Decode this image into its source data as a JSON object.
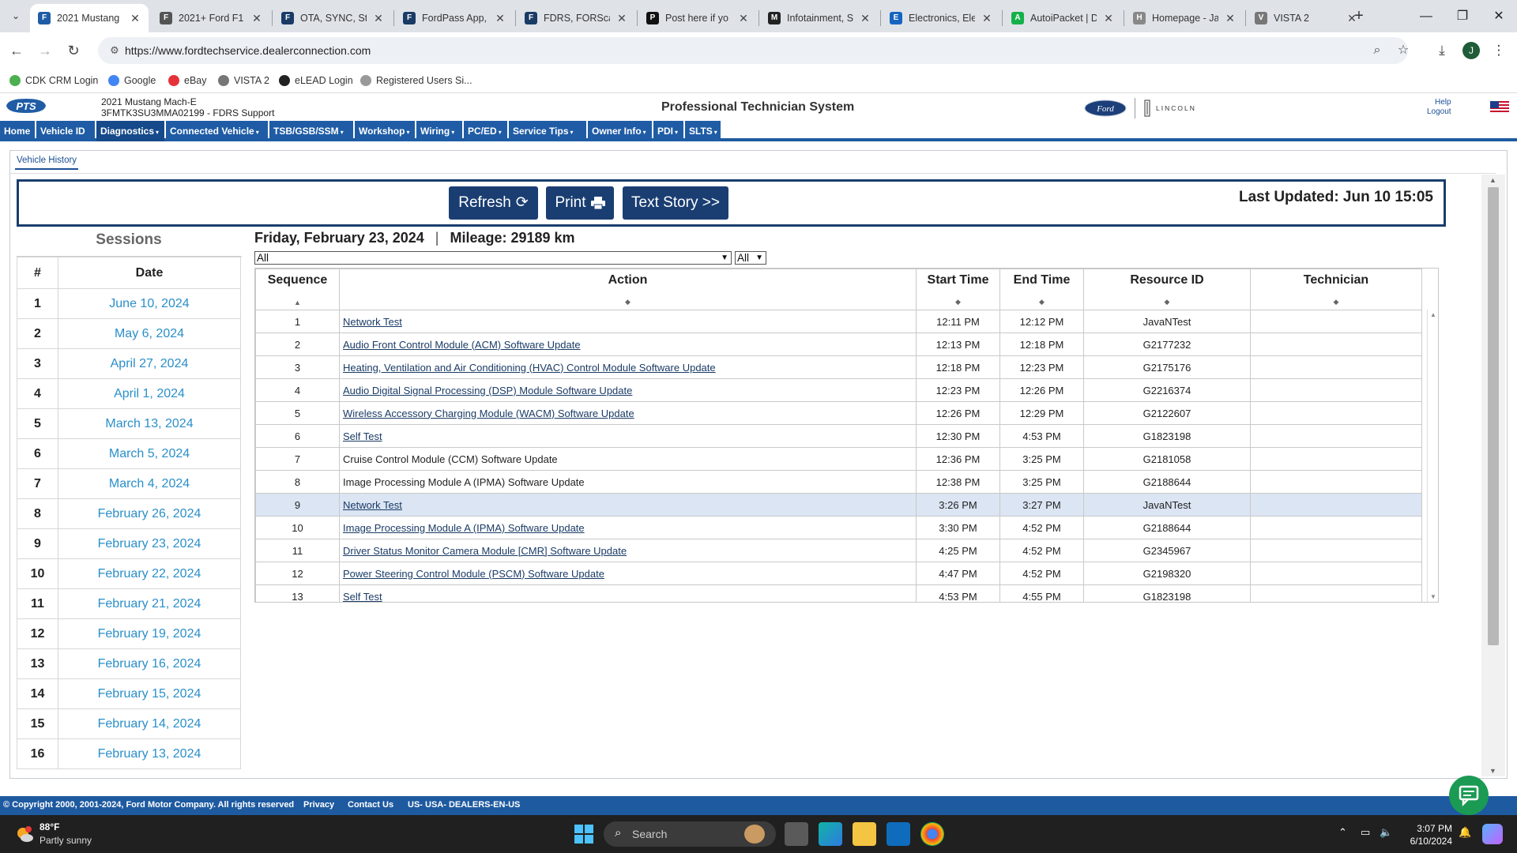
{
  "browser": {
    "tabs": [
      {
        "title": "2021 Mustang",
        "active": true,
        "fav_color": "#1f5ca5",
        "fav": "F"
      },
      {
        "title": "2021+ Ford F1",
        "fav_color": "#555555",
        "fav": "F"
      },
      {
        "title": "OTA, SYNC, Ste",
        "fav_color": "#1a3b66",
        "fav": "F"
      },
      {
        "title": "FordPass App,",
        "fav_color": "#1a3b66",
        "fav": "F"
      },
      {
        "title": "FDRS, FORScan",
        "fav_color": "#1a3b66",
        "fav": "F"
      },
      {
        "title": "Post here if yo",
        "fav_color": "#111111",
        "fav": "P"
      },
      {
        "title": "Infotainment, S",
        "fav_color": "#222222",
        "fav": "M"
      },
      {
        "title": "Electronics, Ele",
        "fav_color": "#1565c0",
        "fav": "E"
      },
      {
        "title": "AutoiPacket | D",
        "fav_color": "#16b04a",
        "fav": "A"
      },
      {
        "title": "Homepage - Ja",
        "fav_color": "#888888",
        "fav": "H"
      },
      {
        "title": "VISTA 2",
        "fav_color": "#777777",
        "fav": "V"
      }
    ],
    "url": "https://www.fordtechservice.dealerconnection.com",
    "bookmarks": [
      {
        "label": "CDK CRM Login",
        "color": "#4caf50"
      },
      {
        "label": "Google",
        "color": "#4285f4"
      },
      {
        "label": "eBay",
        "color": "#e53238"
      },
      {
        "label": "VISTA 2",
        "color": "#777777"
      },
      {
        "label": "eLEAD Login",
        "color": "#222222"
      },
      {
        "label": "Registered Users Si...",
        "color": "#999999"
      }
    ],
    "profile_initial": "J"
  },
  "header": {
    "vehicle_line1": "2021 Mustang Mach-E",
    "vehicle_line2": "3FMTK3SU3MMA02199 - FDRS Support",
    "app_title": "Professional Technician System",
    "lincoln": "LINCOLN",
    "ford_logo_text": "Ford",
    "pts_logo_text": "PTS",
    "help": "Help",
    "logout": "Logout"
  },
  "nav": [
    {
      "label": "Home"
    },
    {
      "label": "Vehicle ID"
    },
    {
      "label": "Diagnostics",
      "selected": true
    },
    {
      "label": "Connected Vehicle"
    },
    {
      "label": "TSB/GSB/SSM"
    },
    {
      "label": "Workshop"
    },
    {
      "label": "Wiring"
    },
    {
      "label": "PC/ED"
    },
    {
      "label": "Service Tips"
    },
    {
      "label": "Owner Info"
    },
    {
      "label": "PDI"
    },
    {
      "label": "SLTS"
    }
  ],
  "subtab": "Vehicle History",
  "toolbar": {
    "refresh": "Refresh",
    "print": "Print",
    "text_story": "Text Story >>",
    "last_updated": "Last Updated: Jun 10 15:05"
  },
  "sessions": {
    "title": "Sessions",
    "col_num": "#",
    "col_date": "Date",
    "rows": [
      {
        "num": "1",
        "date": "June 10, 2024"
      },
      {
        "num": "2",
        "date": "May 6, 2024"
      },
      {
        "num": "3",
        "date": "April 27, 2024"
      },
      {
        "num": "4",
        "date": "April 1, 2024"
      },
      {
        "num": "5",
        "date": "March 13, 2024"
      },
      {
        "num": "6",
        "date": "March 5, 2024"
      },
      {
        "num": "7",
        "date": "March 4, 2024"
      },
      {
        "num": "8",
        "date": "February 26, 2024"
      },
      {
        "num": "9",
        "date": "February 23, 2024"
      },
      {
        "num": "10",
        "date": "February 22, 2024"
      },
      {
        "num": "11",
        "date": "February 21, 2024"
      },
      {
        "num": "12",
        "date": "February 19, 2024"
      },
      {
        "num": "13",
        "date": "February 16, 2024"
      },
      {
        "num": "14",
        "date": "February 15, 2024"
      },
      {
        "num": "15",
        "date": "February 14, 2024"
      },
      {
        "num": "16",
        "date": "February 13, 2024"
      }
    ]
  },
  "detail": {
    "date": "Friday, February 23, 2024",
    "separator": "|",
    "mileage": "Mileage: 29189 km",
    "filter1": "All",
    "filter2": "All",
    "columns": {
      "sequence": "Sequence",
      "action": "Action",
      "start": "Start Time",
      "end": "End Time",
      "resource": "Resource ID",
      "technician": "Technician"
    },
    "rows": [
      {
        "seq": "1",
        "action": "Network Test",
        "link": true,
        "start": "12:11 PM",
        "end": "12:12 PM",
        "res": "JavaNTest",
        "tech": ""
      },
      {
        "seq": "2",
        "action": "Audio Front Control Module (ACM) Software Update",
        "link": true,
        "start": "12:13 PM",
        "end": "12:18 PM",
        "res": "G2177232",
        "tech": ""
      },
      {
        "seq": "3",
        "action": "Heating, Ventilation and Air Conditioning (HVAC) Control Module Software Update",
        "link": true,
        "start": "12:18 PM",
        "end": "12:23 PM",
        "res": "G2175176",
        "tech": ""
      },
      {
        "seq": "4",
        "action": "Audio Digital Signal Processing (DSP) Module Software Update",
        "link": true,
        "start": "12:23 PM",
        "end": "12:26 PM",
        "res": "G2216374",
        "tech": ""
      },
      {
        "seq": "5",
        "action": "Wireless Accessory Charging Module (WACM) Software Update",
        "link": true,
        "start": "12:26 PM",
        "end": "12:29 PM",
        "res": "G2122607",
        "tech": ""
      },
      {
        "seq": "6",
        "action": "Self Test",
        "link": true,
        "start": "12:30 PM",
        "end": "4:53 PM",
        "res": "G1823198",
        "tech": ""
      },
      {
        "seq": "7",
        "action": "Cruise Control Module (CCM) Software Update",
        "link": false,
        "start": "12:36 PM",
        "end": "3:25 PM",
        "res": "G2181058",
        "tech": ""
      },
      {
        "seq": "8",
        "action": "Image Processing Module A (IPMA) Software Update",
        "link": false,
        "start": "12:38 PM",
        "end": "3:25 PM",
        "res": "G2188644",
        "tech": ""
      },
      {
        "seq": "9",
        "action": "Network Test",
        "link": true,
        "start": "3:26 PM",
        "end": "3:27 PM",
        "res": "JavaNTest",
        "tech": "",
        "highlight": true
      },
      {
        "seq": "10",
        "action": "Image Processing Module A (IPMA) Software Update",
        "link": true,
        "start": "3:30 PM",
        "end": "4:52 PM",
        "res": "G2188644",
        "tech": ""
      },
      {
        "seq": "11",
        "action": "Driver Status Monitor Camera Module [CMR] Software Update",
        "link": true,
        "start": "4:25 PM",
        "end": "4:52 PM",
        "res": "G2345967",
        "tech": ""
      },
      {
        "seq": "12",
        "action": "Power Steering Control Module (PSCM) Software Update",
        "link": true,
        "start": "4:47 PM",
        "end": "4:52 PM",
        "res": "G2198320",
        "tech": ""
      },
      {
        "seq": "13",
        "action": "Self Test",
        "link": true,
        "start": "4:53 PM",
        "end": "4:55 PM",
        "res": "G1823198",
        "tech": ""
      }
    ]
  },
  "footer": {
    "copyright": "© Copyright 2000, 2001-2024, Ford Motor Company. All rights reserved",
    "privacy": "Privacy",
    "contact": "Contact Us",
    "locale": "US- USA- DEALERS-EN-US"
  },
  "taskbar": {
    "temp": "88°F",
    "weather": "Partly sunny",
    "search": "Search",
    "time": "3:07 PM",
    "date": "6/10/2024"
  }
}
